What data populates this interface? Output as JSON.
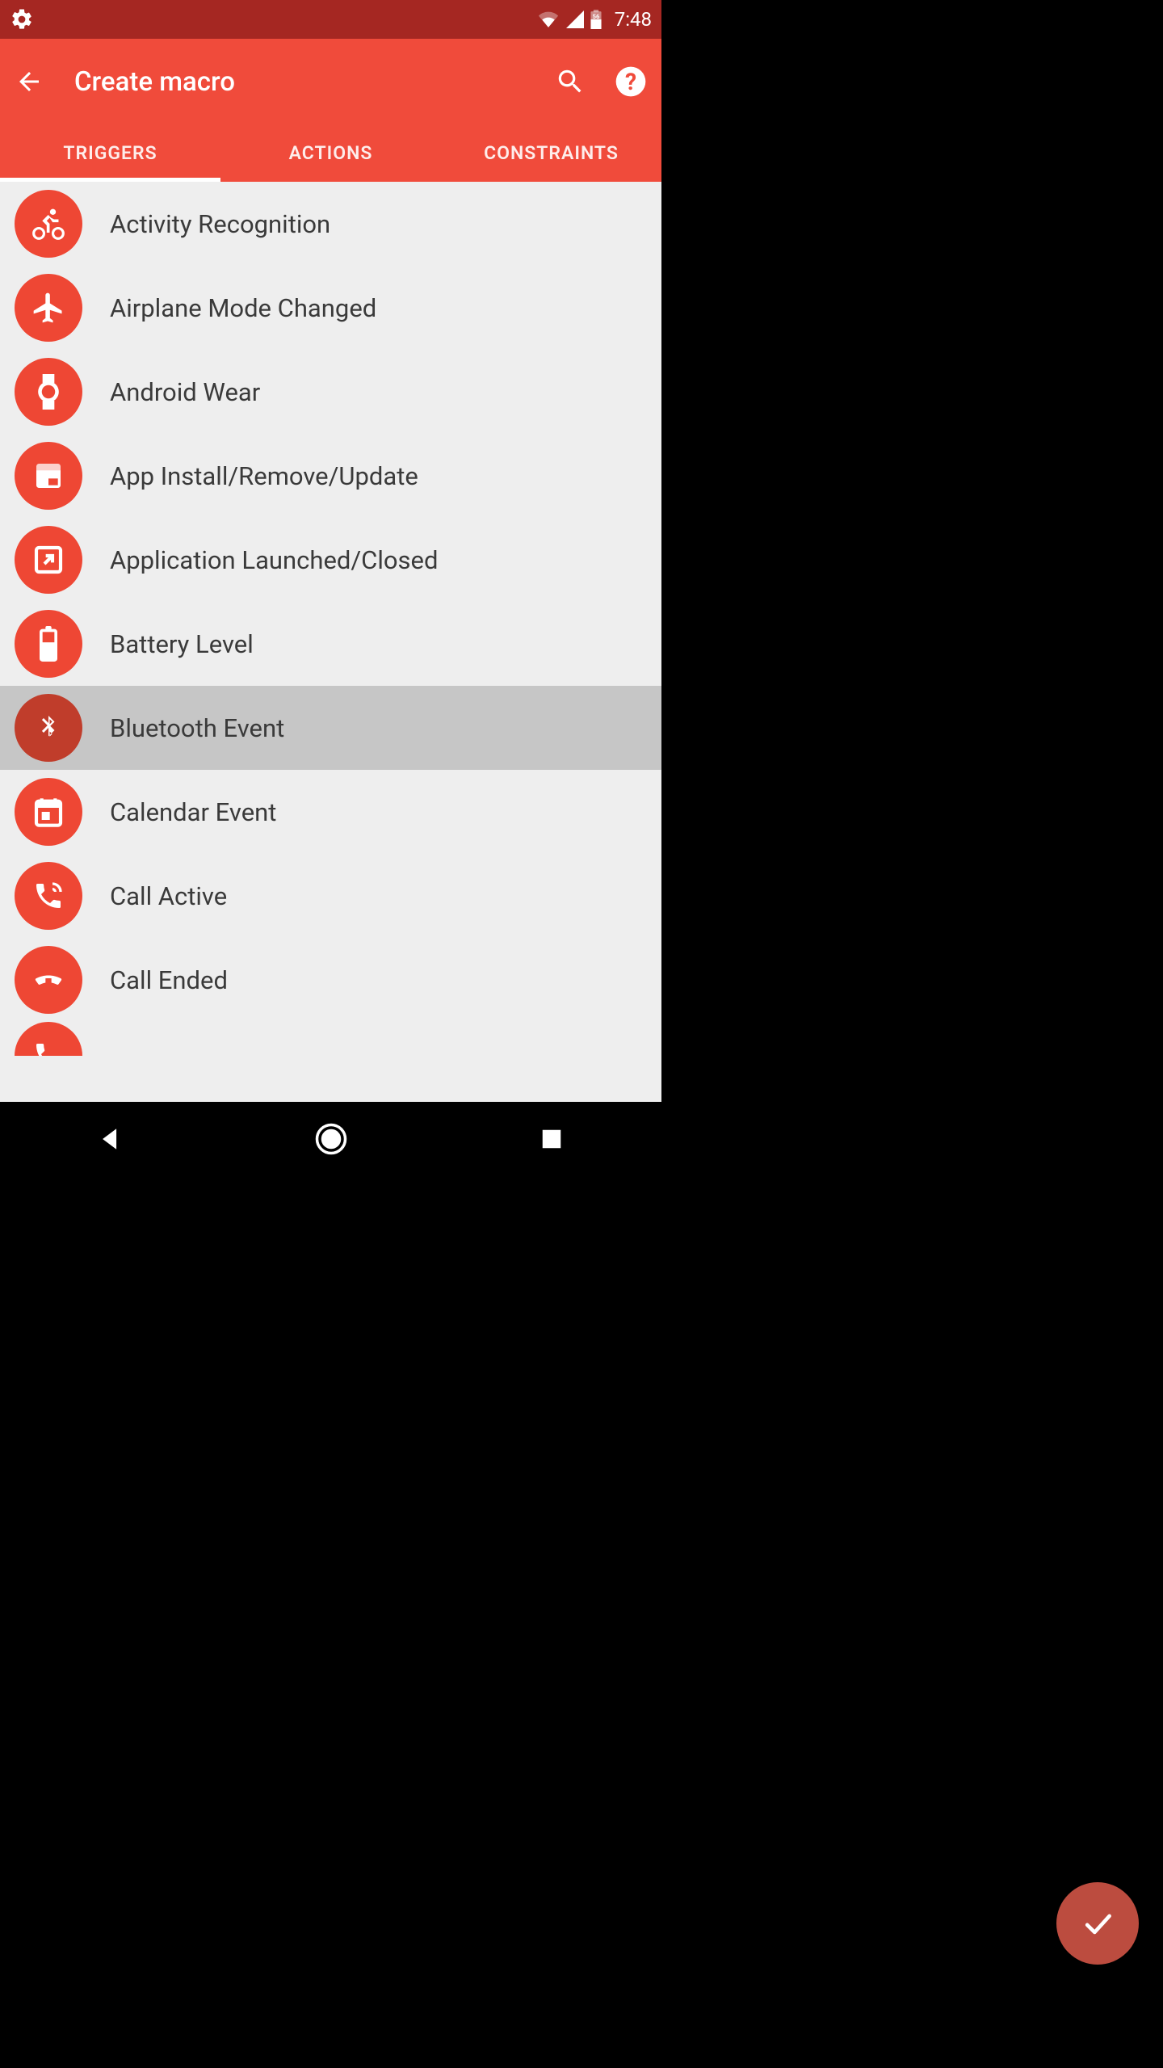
{
  "status": {
    "time": "7:48",
    "battery_level": "56"
  },
  "toolbar": {
    "title": "Create macro"
  },
  "tabs": {
    "0": {
      "label": "TRIGGERS"
    },
    "1": {
      "label": "ACTIONS"
    },
    "2": {
      "label": "CONSTRAINTS"
    },
    "active_index": 0
  },
  "triggers": [
    {
      "icon": "bike-icon",
      "label": "Activity Recognition",
      "highlighted": false
    },
    {
      "icon": "airplane-icon",
      "label": "Airplane Mode Changed",
      "highlighted": false
    },
    {
      "icon": "watch-icon",
      "label": "Android Wear",
      "highlighted": false
    },
    {
      "icon": "package-icon",
      "label": "App Install/Remove/Update",
      "highlighted": false
    },
    {
      "icon": "app-launch-icon",
      "label": "Application Launched/Closed",
      "highlighted": false
    },
    {
      "icon": "battery-icon",
      "label": "Battery Level",
      "highlighted": false
    },
    {
      "icon": "bluetooth-icon",
      "label": "Bluetooth Event",
      "highlighted": true
    },
    {
      "icon": "calendar-icon",
      "label": "Calendar Event",
      "highlighted": false
    },
    {
      "icon": "call-active-icon",
      "label": "Call Active",
      "highlighted": false
    },
    {
      "icon": "call-ended-icon",
      "label": "Call Ended",
      "highlighted": false
    }
  ],
  "colors": {
    "status_bar": "#A52722",
    "app_bar": "#F04B3B",
    "icon_circle": "#EE4734",
    "icon_circle_pressed": "#C03D2B",
    "list_bg": "#eeeeee",
    "highlight_bg": "#c6c6c6",
    "fab": "rgba(241,97,81,0.78)"
  }
}
